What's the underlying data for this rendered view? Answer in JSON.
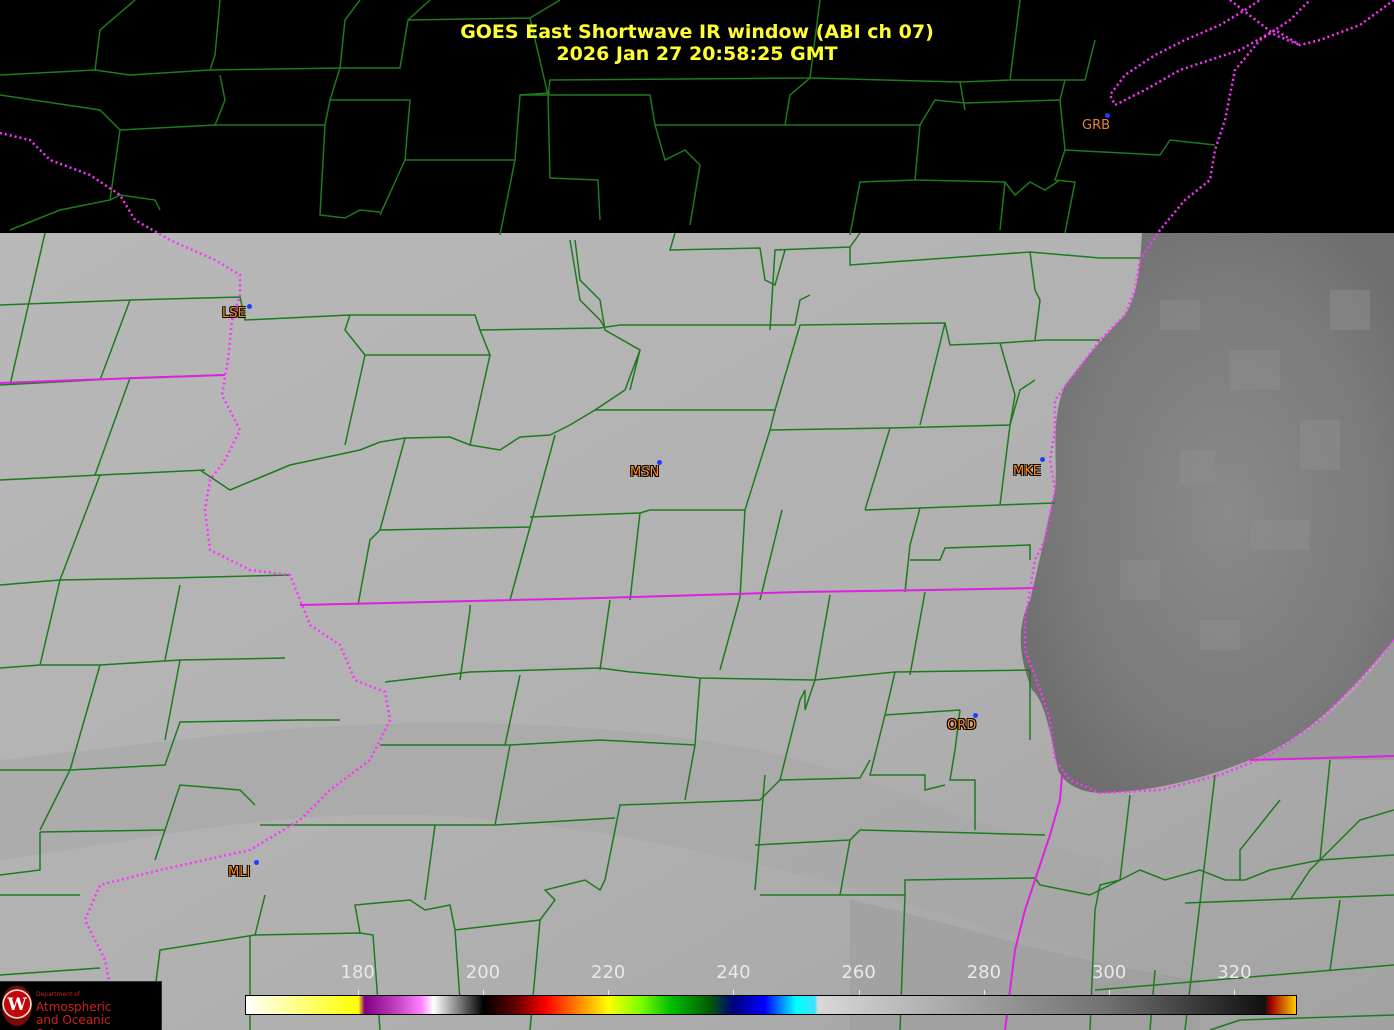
{
  "title": {
    "line1": "GOES East Shortwave IR window (ABI ch 07)",
    "line2": "2026 Jan 27  20:58:25 GMT"
  },
  "cities": [
    {
      "id": "GRB",
      "label": "GRB",
      "color": "#e8823a"
    },
    {
      "id": "LSE",
      "label": "LSE",
      "color": "#ff8c1a"
    },
    {
      "id": "MSN",
      "label": "MSN",
      "color": "#ff8c1a"
    },
    {
      "id": "MKE",
      "label": "MKE",
      "color": "#ff8c1a"
    },
    {
      "id": "ORD",
      "label": "ORD",
      "color": "#ff8c1a"
    },
    {
      "id": "MLI",
      "label": "MLI",
      "color": "#ff8c1a"
    }
  ],
  "colorbar": {
    "min": 162,
    "max": 330,
    "ticks": [
      "180",
      "200",
      "220",
      "240",
      "260",
      "280",
      "300",
      "320"
    ],
    "tick_values": [
      180,
      200,
      220,
      240,
      260,
      280,
      300,
      320
    ],
    "stops": [
      {
        "value": 162,
        "color": "#ffffff"
      },
      {
        "value": 175,
        "color": "#ffff40"
      },
      {
        "value": 180,
        "color": "#ffff00"
      },
      {
        "value": 181,
        "color": "#800080"
      },
      {
        "value": 186,
        "color": "#c040c0"
      },
      {
        "value": 190,
        "color": "#ff80ff"
      },
      {
        "value": 192,
        "color": "#ffffff"
      },
      {
        "value": 196,
        "color": "#808080"
      },
      {
        "value": 200,
        "color": "#000000"
      },
      {
        "value": 205,
        "color": "#600000"
      },
      {
        "value": 210,
        "color": "#ff0000"
      },
      {
        "value": 215,
        "color": "#ff8000"
      },
      {
        "value": 220,
        "color": "#ffff00"
      },
      {
        "value": 225,
        "color": "#80ff00"
      },
      {
        "value": 230,
        "color": "#00c000"
      },
      {
        "value": 236,
        "color": "#006000"
      },
      {
        "value": 240,
        "color": "#000080"
      },
      {
        "value": 245,
        "color": "#0000ff"
      },
      {
        "value": 250,
        "color": "#00ffff"
      },
      {
        "value": 253,
        "color": "#40e0ff"
      },
      {
        "value": 253.5,
        "color": "#d8d8d8"
      },
      {
        "value": 300,
        "color": "#707070"
      },
      {
        "value": 325,
        "color": "#101010"
      },
      {
        "value": 326,
        "color": "#a00000"
      },
      {
        "value": 330,
        "color": "#ffcc00"
      }
    ]
  },
  "logo": {
    "department": "Department of",
    "line1": "Atmospheric",
    "line2": "and Oceanic Sciences",
    "seal_letter": "W"
  },
  "colors": {
    "county_lines": "#1e7a1e",
    "state_lines": "#e020e0",
    "imagery_land": "#b4b4b4",
    "imagery_lake": "#7c7c7c",
    "no_data": "#000000",
    "title_text": "#ffff33"
  }
}
